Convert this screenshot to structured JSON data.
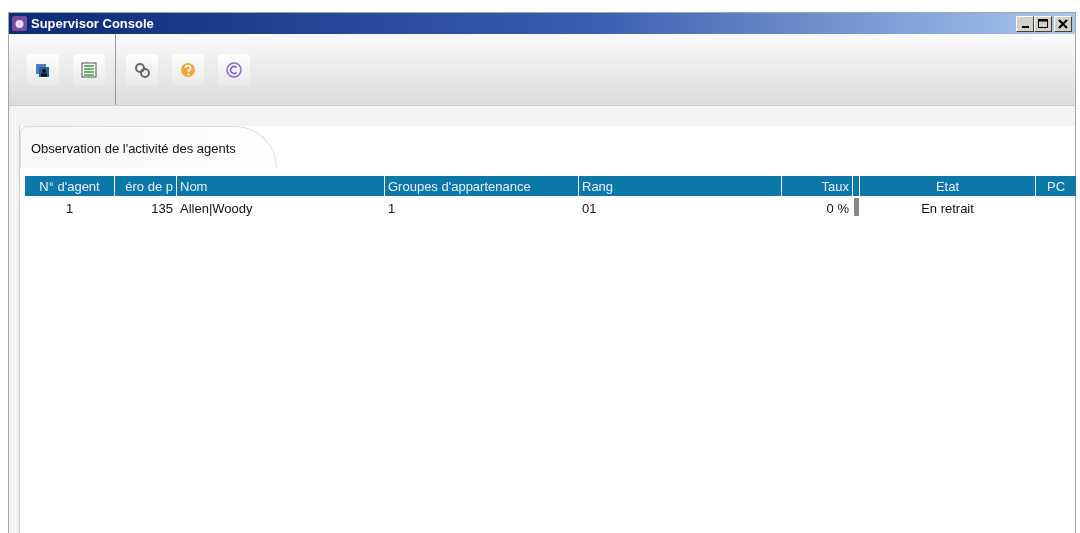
{
  "window": {
    "title": "Supervisor Console"
  },
  "toolbar": {
    "groups": [
      [
        {
          "kind": "agents"
        },
        {
          "kind": "list"
        }
      ],
      [
        {
          "kind": "gears"
        },
        {
          "kind": "help"
        },
        {
          "kind": "copyright"
        }
      ]
    ]
  },
  "tabs": [
    {
      "label": "Observation de l'activité des agents",
      "selected": true
    }
  ],
  "table": {
    "columns": [
      {
        "label": "N° d'agent"
      },
      {
        "label": "éro de p"
      },
      {
        "label": "Nom"
      },
      {
        "label": "Groupes d'appartenance"
      },
      {
        "label": "Rang"
      },
      {
        "label": "Taux"
      },
      {},
      {
        "label": "Etat"
      },
      {
        "label": "PC"
      }
    ],
    "rows": [
      [
        "1",
        "135",
        "Allen|Woody",
        "1",
        "01",
        "0 %",
        "",
        "En retrait",
        ""
      ]
    ]
  }
}
